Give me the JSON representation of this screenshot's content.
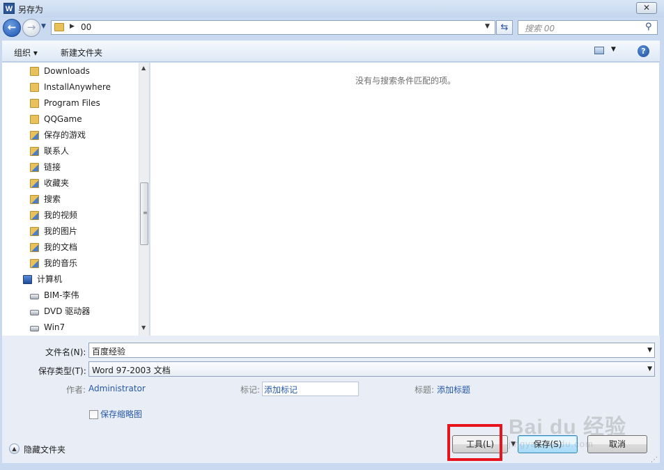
{
  "window": {
    "title": "另存为",
    "app_icon": "W",
    "close_label": "✕"
  },
  "address": {
    "path": "00",
    "search_placeholder": "搜索 00"
  },
  "toolbar": {
    "organize_label": "组织 ▾",
    "new_folder_label": "新建文件夹",
    "help_label": "?"
  },
  "nav": {
    "items": [
      {
        "label": "Downloads",
        "icon": "folder-icon"
      },
      {
        "label": "InstallAnywhere",
        "icon": "folder-icon"
      },
      {
        "label": "Program Files",
        "icon": "folder-icon"
      },
      {
        "label": "QQGame",
        "icon": "folder-icon"
      },
      {
        "label": "保存的游戏",
        "icon": "saved-games-icon"
      },
      {
        "label": "联系人",
        "icon": "contacts-icon"
      },
      {
        "label": "链接",
        "icon": "links-icon"
      },
      {
        "label": "收藏夹",
        "icon": "favorites-icon"
      },
      {
        "label": "搜索",
        "icon": "searches-icon"
      },
      {
        "label": "我的视频",
        "icon": "videos-icon"
      },
      {
        "label": "我的图片",
        "icon": "pictures-icon"
      },
      {
        "label": "我的文档",
        "icon": "documents-icon"
      },
      {
        "label": "我的音乐",
        "icon": "music-icon"
      },
      {
        "label": "计算机",
        "icon": "computer-icon"
      },
      {
        "label": "BIM-李伟",
        "icon": "drive-icon"
      },
      {
        "label": "DVD 驱动器",
        "icon": "dvd-drive-icon"
      },
      {
        "label": "Win7",
        "icon": "drive-icon"
      }
    ]
  },
  "content": {
    "empty_message": "没有与搜索条件匹配的项。"
  },
  "form": {
    "filename_label": "文件名(N):",
    "filename_value": "百度经验",
    "filetype_label": "保存类型(T):",
    "filetype_value": "Word 97-2003 文档",
    "author_label": "作者:",
    "author_value": "Administrator",
    "tags_label": "标记:",
    "tags_value": "添加标记",
    "title_label": "标题:",
    "title_value": "添加标题",
    "thumbnail_label": "保存缩略图",
    "hide_folders_label": "隐藏文件夹",
    "tools_label": "工具(L)",
    "save_label": "保存(S)",
    "cancel_label": "取消"
  },
  "watermark": {
    "logo": "Bai du 经验",
    "url": "jingyan.baidu.com"
  },
  "colors": {
    "highlight": "#e8141b",
    "link": "#2658a8"
  }
}
